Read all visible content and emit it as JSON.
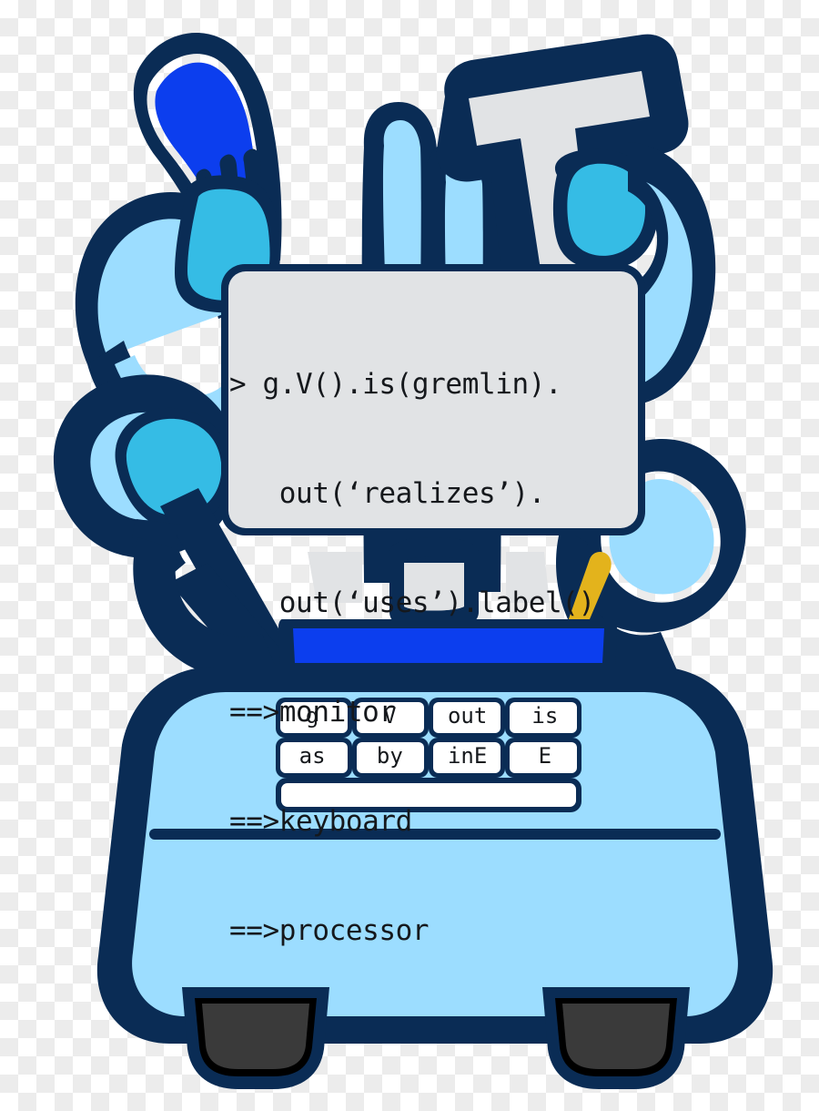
{
  "image": {
    "subject": "gremlin-robot-mascot",
    "background": "transparent-checkerboard"
  },
  "palette": {
    "navy_outline": "#0a2c55",
    "body_light_blue": "#9cddff",
    "accent_cyan": "#35bce5",
    "bright_blue": "#0c3eee",
    "console_grey": "#e1e3e5",
    "foot_dark_grey": "#3a3a3a",
    "foot_black": "#000000",
    "gold": "#e3b31c",
    "checker_light": "#ececec",
    "checker_white": "#ffffff"
  },
  "console": {
    "name": "gremlin-console",
    "lines": [
      "> g.V().is(gremlin).",
      "   out(‘realizes’).",
      "   out(‘uses’).label()",
      "==>monitor",
      "==>keyboard",
      "==>processor"
    ],
    "prompt": ">",
    "query": "g.V().is(gremlin).out('realizes').out('uses').label()",
    "results": [
      "monitor",
      "keyboard",
      "processor"
    ]
  },
  "keyboard": {
    "name": "gremlin-keyboard",
    "rows": [
      {
        "keys": [
          "g",
          "V",
          "out",
          "is"
        ]
      },
      {
        "keys": [
          "as",
          "by",
          "inE",
          "E"
        ]
      },
      {
        "keys": [
          ""
        ]
      }
    ],
    "spacebar_label": ""
  },
  "figure": {
    "head_logo": "tinkerpop-t-hammer",
    "limbs": [
      "upper-left-wing",
      "upper-right-hammer-arm",
      "mid-left-arm",
      "mid-right-arm",
      "finger-tentacles"
    ],
    "feet": [
      "left-foot",
      "right-foot"
    ]
  }
}
